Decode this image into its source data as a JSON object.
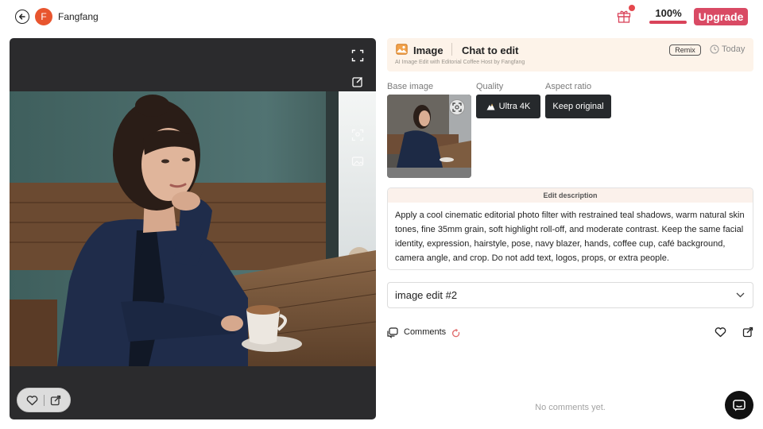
{
  "user": {
    "name": "Fangfang",
    "initial": "F"
  },
  "topbar": {
    "credits": "100%",
    "upgrade_label": "Upgrade"
  },
  "card": {
    "title": "Image",
    "chat_label": "Chat to edit",
    "subtitle": "AI Image Edit with Editorial Coffee Host by Fangfang",
    "remix_label": "Remix",
    "date": "Today"
  },
  "settings": {
    "base_image_label": "Base image",
    "quality_label": "Quality",
    "quality_value": "Ultra 4K",
    "aspect_label": "Aspect ratio",
    "aspect_value": "Keep original"
  },
  "description": {
    "heading": "Edit description",
    "text": "Apply a cool cinematic editorial photo filter with restrained teal shadows, warm natural skin tones, fine 35mm grain, soft highlight roll-off, and moderate contrast. Keep the same facial identity, expression, hairstyle, pose, navy blazer, hands, coffee cup, café background, camera angle, and crop. Do not add text, logos, props, or extra people."
  },
  "version_select": {
    "value": "image edit #2"
  },
  "comments": {
    "title": "Comments",
    "empty_text": "No comments yet."
  },
  "colors": {
    "upgrade": "#d94a64",
    "avatar": "#e8552e",
    "canvas": "#2b2b2d",
    "chip": "#26292c"
  }
}
